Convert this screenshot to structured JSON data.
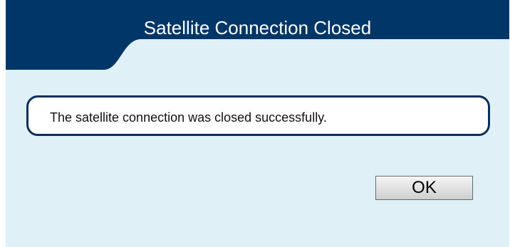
{
  "dialog": {
    "title": "Satellite Connection Closed",
    "message": "The satellite connection was closed successfully.",
    "ok_label": "OK"
  },
  "colors": {
    "header": "#013668",
    "background": "#dff0f7",
    "message_border": "#0b2f5c",
    "button_border": "#5d6a74"
  }
}
